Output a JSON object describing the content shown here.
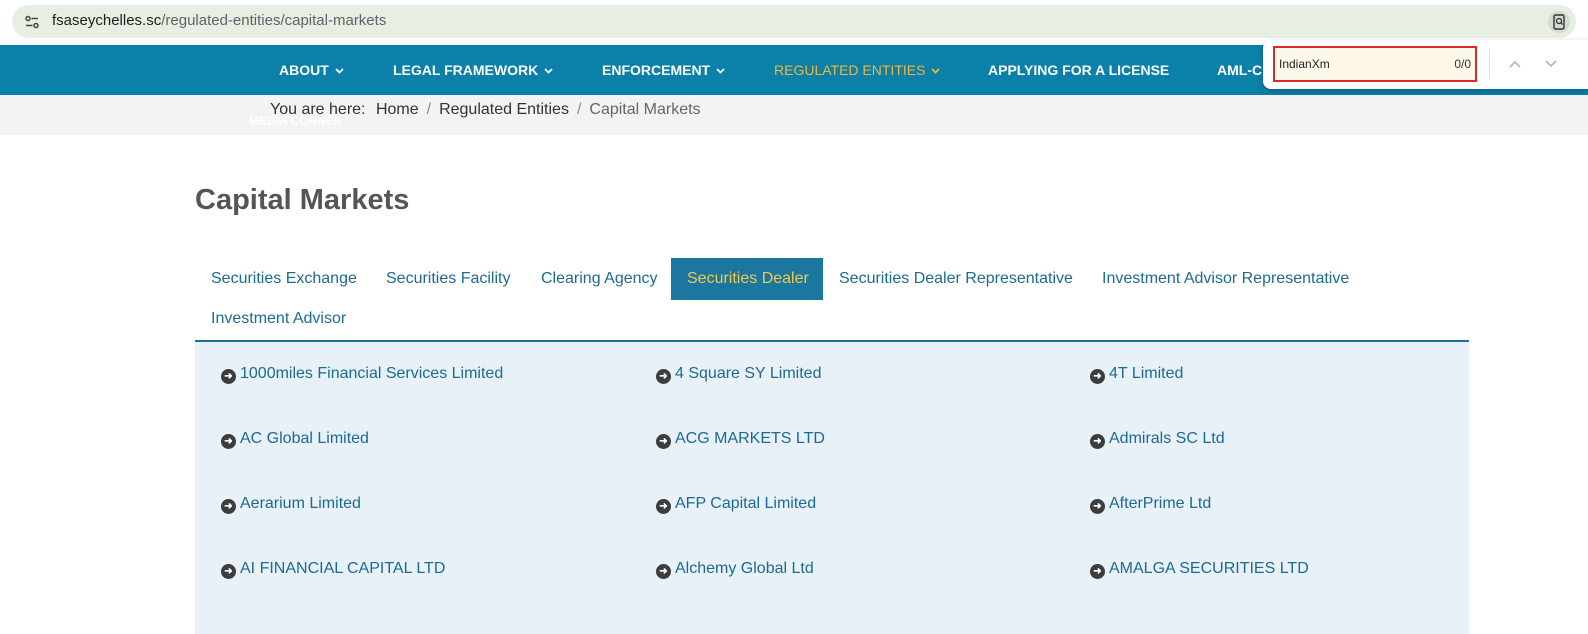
{
  "browser": {
    "url_domain": "fsaseychelles.sc",
    "url_path": "/regulated-entities/capital-markets"
  },
  "nav": {
    "items": [
      {
        "label": "ABOUT",
        "has_dropdown": true
      },
      {
        "label": "LEGAL FRAMEWORK",
        "has_dropdown": true
      },
      {
        "label": "ENFORCEMENT",
        "has_dropdown": true
      },
      {
        "label": "REGULATED ENTITIES",
        "has_dropdown": true,
        "active": true
      },
      {
        "label": "APPLYING FOR A LICENSE",
        "has_dropdown": false
      },
      {
        "label": "AML-C",
        "has_dropdown": false
      }
    ],
    "overflow_label": "MEDIA CORNER",
    "active_color": "#f0b73e",
    "background_color": "#0b80a8"
  },
  "breadcrumb": {
    "prefix": "You are here:",
    "items": [
      "Home",
      "Regulated Entities",
      "Capital Markets"
    ],
    "separator": "/"
  },
  "find_bar": {
    "query": "IndianXm",
    "count": "0/0"
  },
  "page": {
    "title": "Capital Markets"
  },
  "tabs": [
    {
      "label": "Securities Exchange"
    },
    {
      "label": "Securities Facility"
    },
    {
      "label": "Clearing Agency"
    },
    {
      "label": "Securities Dealer",
      "active": true
    },
    {
      "label": "Securities Dealer Representative"
    },
    {
      "label": "Investment Advisor Representative"
    },
    {
      "label": "Investment Advisor"
    }
  ],
  "entities": [
    "1000miles Financial Services Limited",
    "4 Square SY Limited",
    "4T Limited",
    "AC Global Limited",
    "ACG MARKETS LTD",
    "Admirals SC Ltd",
    "Aerarium Limited",
    "AFP Capital Limited",
    "AfterPrime Ltd",
    "AI FINANCIAL CAPITAL LTD",
    "Alchemy Global Ltd",
    "AMALGA SECURITIES LTD"
  ]
}
